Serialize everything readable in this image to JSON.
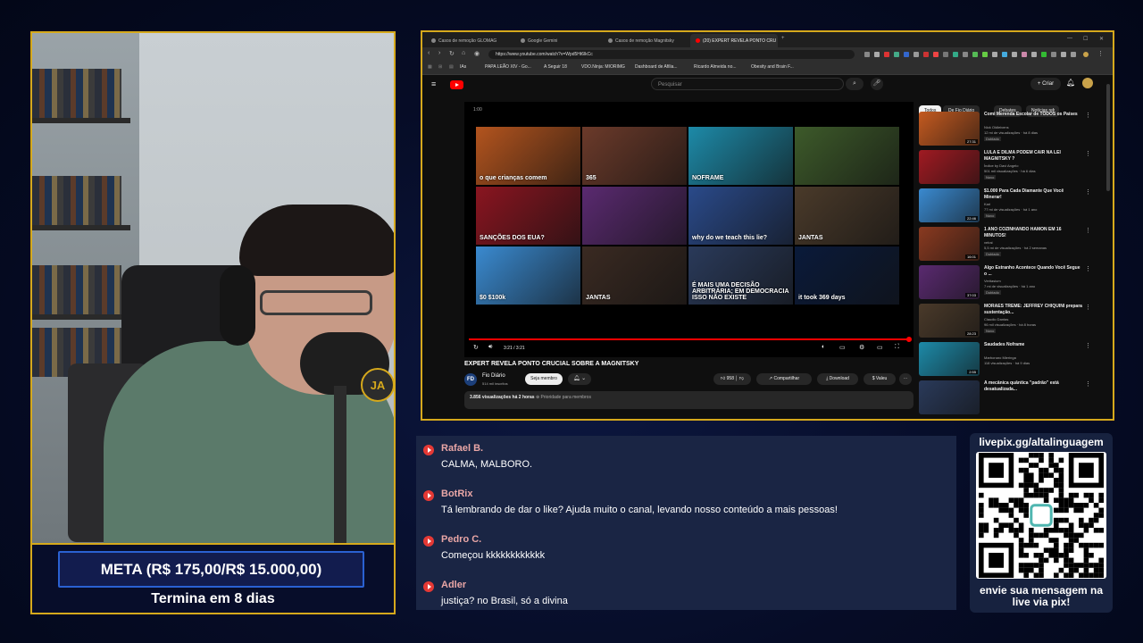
{
  "meta": {
    "goal": "META (R$ 175,00/R$ 15.000,00)",
    "ends": "Termina em 8 dias"
  },
  "cam": {
    "mic_badge": "JA"
  },
  "browser": {
    "tabs": [
      "Casos de remoção GLOMAG",
      "Google Gemini",
      "Casos de remoção Magnitsky",
      "(20) EXPERT REVELA PONTO CRU"
    ],
    "url": "https://www.youtube.com/watch?v=Wpd5Ht6lkCc",
    "bookmarks": [
      "IAs",
      "PAPA LEÃO XIV - Go...",
      "A Seguir 18",
      "VDO.Ninja: MIORIMG",
      "Dashboard de Afilia...",
      "Ricardo Almeida no...",
      "Obesity and Brain F..."
    ]
  },
  "youtube": {
    "search_placeholder": "Pesquisar",
    "create_label": "Criar",
    "notif_count": "9+",
    "player": {
      "time_top": "1:00",
      "time": "3:21 / 3:21",
      "thumbs": [
        {
          "label": "o que crianças comem",
          "color": "#b3541e"
        },
        {
          "label": "365",
          "color": "#6b3a2a"
        },
        {
          "label": "NOFRAME",
          "color": "#1d8aa8"
        },
        {
          "label": "",
          "color": "#3d5a2a"
        },
        {
          "label": "SANÇÕES DOS EUA?",
          "color": "#8a1520"
        },
        {
          "label": "",
          "color": "#5a2a70"
        },
        {
          "label": "why do we teach this lie?",
          "color": "#2a4a8a"
        },
        {
          "label": "JANTAS",
          "color": "#4a3a2a"
        },
        {
          "label": "$0 $100k",
          "color": "#3a8ad0"
        },
        {
          "label": "JANTAS",
          "color": "#3a2a22"
        },
        {
          "label": "É MAIS UMA DECISÃO ARBITRÁRIA; EM DEMOCRACIA ISSO NÃO EXISTE",
          "color": "#2a3a5a"
        },
        {
          "label": "it took 369 days",
          "color": "#0a1a3a"
        }
      ]
    },
    "video_title": "EXPERT REVELA PONTO CRUCIAL SOBRE A MAGNITSKY",
    "channel": {
      "initials": "FD",
      "name": "Fio Diário",
      "subs": "514 mil inscritos"
    },
    "member_button": "Seja membro",
    "likes": "958",
    "share": "Compartilhar",
    "download": "Download",
    "thanks": "Valeu",
    "views": "3.856 visualizações",
    "age": "há 2 horas",
    "priority": "Prioridade para membros",
    "chips": [
      "Todos",
      "De Fio Diário",
      "Debates",
      "Notícias rel"
    ],
    "recommendations": [
      {
        "title": "Comi Merenda Escolar de TODOS os Países",
        "channel": "Nick Oldleivens",
        "meta": "12 mi de visualizações · há 8 dias",
        "badge": "Dublado",
        "dur": "27:31",
        "color": "#c45a20"
      },
      {
        "title": "LULA E DILMA PODEM CAIR NA LEI MAGNITSKY ?",
        "channel": "Índice by Davi Angelo",
        "meta": "501 mil visualizações · há 6 dias",
        "badge": "Novo",
        "dur": "",
        "color": "#a01a22"
      },
      {
        "title": "$1.000 Para Cada Diamante Que Você Minerar!",
        "channel": "Kari",
        "meta": "77 mi de visualizações · há 1 ano",
        "badge": "Novo",
        "dur": "22:46",
        "color": "#3a8ad0"
      },
      {
        "title": "1 ANO COZINHANDO HAMON EM 16 MINUTOS!",
        "channel": "velrai",
        "meta": "5,5 mi de visualizações · há 2 semanas",
        "badge": "Dublado",
        "dur": "16:01",
        "color": "#8a3a20"
      },
      {
        "title": "Algo Estranho Acontece Quando Você Segue o ...",
        "channel": "Veritasium",
        "meta": "7 mi de visualizações · há 1 ano",
        "badge": "Dublado",
        "dur": "37:03",
        "color": "#5a2a70"
      },
      {
        "title": "MORAES TREME: JEFFREY CHIQUINI prepara sustentação...",
        "channel": "Claudio Dantas",
        "meta": "96 mil visualizações · há 8 horas",
        "badge": "Novo",
        "dur": "28:23",
        "color": "#4a3a2a"
      },
      {
        "title": "Saudades Noframe",
        "channel": "Marbonaro Mieringa",
        "meta": "118 visualizações · há 9 dias",
        "badge": "",
        "dur": "2:55",
        "color": "#1d8aa8"
      },
      {
        "title": "A mecânica quântica \"padrão\" está desatualizada...",
        "channel": "",
        "meta": "",
        "badge": "",
        "dur": "",
        "color": "#2a3a5a"
      }
    ]
  },
  "chat": [
    {
      "user": "Rafael B.",
      "text": "CALMA, MALBORO."
    },
    {
      "user": "BotRix",
      "text": "Tá lembrando de dar o like? Ajuda muito o canal, levando nosso conteúdo a mais pessoas!"
    },
    {
      "user": "Pedro C.",
      "text": "Começou kkkkkkkkkkkk"
    },
    {
      "user": "Adler",
      "text": "justiça? no Brasil, só a divina"
    }
  ],
  "pix": {
    "url": "livepix.gg/altalinguagem",
    "message": "envie sua mensagem na live via pix!"
  }
}
